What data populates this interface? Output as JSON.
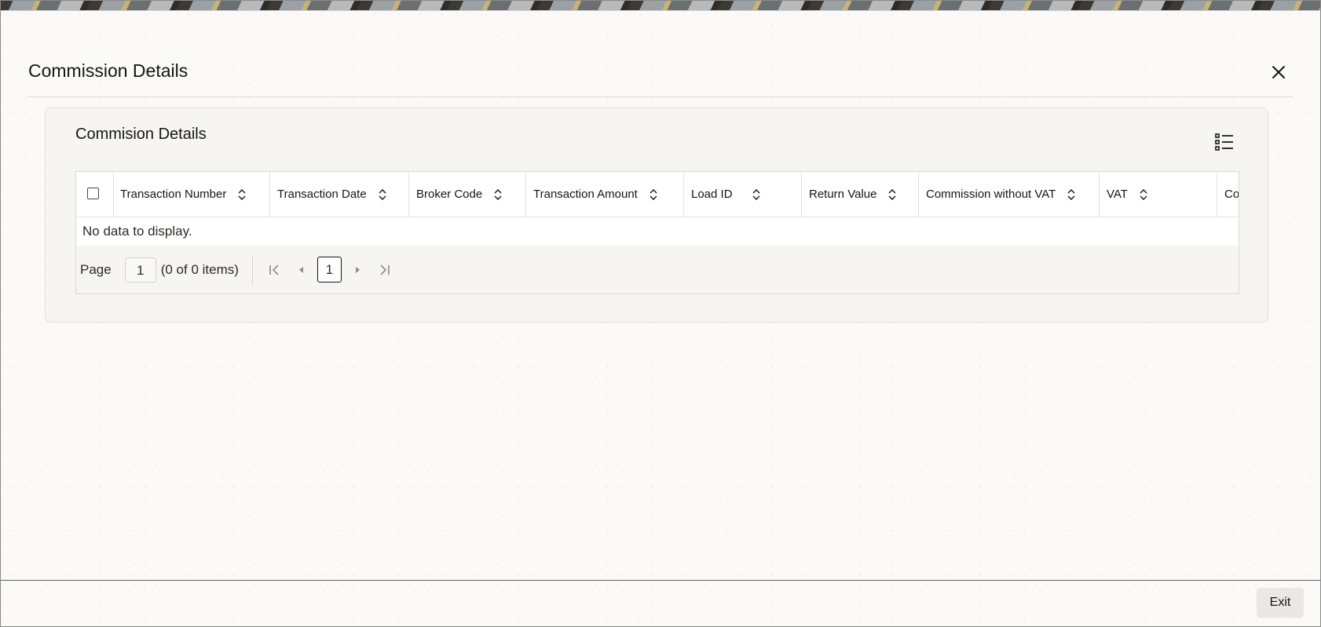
{
  "dialog": {
    "title": "Commission Details",
    "close_icon": "close-icon"
  },
  "panel": {
    "title": "Commision Details",
    "list_icon": "column-list-icon"
  },
  "grid": {
    "columns": [
      "Transaction Number",
      "Transaction Date",
      "Broker Code",
      "Transaction Amount",
      "Load ID",
      "Return Value",
      "Commission without VAT",
      "VAT",
      "Co"
    ],
    "empty_message": "No data to display."
  },
  "pager": {
    "page_label": "Page",
    "page_value": "1",
    "items_info": "(0 of 0 items)",
    "current_page": "1"
  },
  "footer": {
    "exit_label": "Exit"
  }
}
